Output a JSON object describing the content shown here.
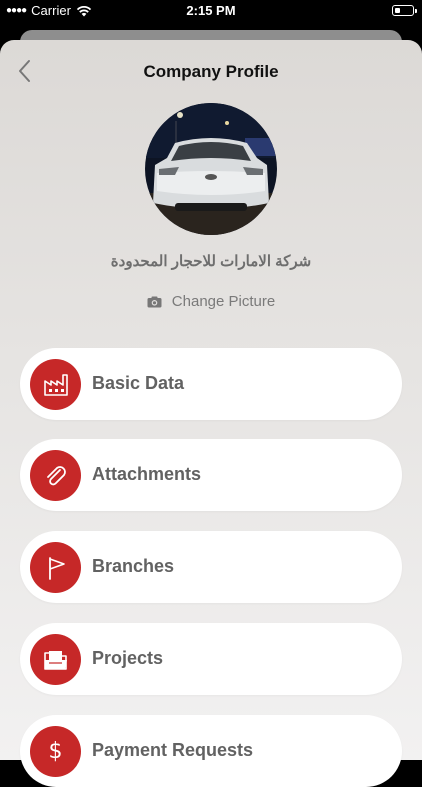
{
  "status_bar": {
    "carrier": "Carrier",
    "time": "2:15 PM"
  },
  "nav": {
    "title": "Company Profile",
    "back_icon": "chevron-left-icon"
  },
  "profile": {
    "company_name": "شركة الامارات للاحجار المحدودة",
    "change_picture_label": "Change Picture",
    "change_picture_icon": "camera-icon"
  },
  "menu": {
    "items": [
      {
        "label": "Basic Data",
        "icon": "factory-icon"
      },
      {
        "label": "Attachments",
        "icon": "paperclip-icon"
      },
      {
        "label": "Branches",
        "icon": "flag-icon"
      },
      {
        "label": "Projects",
        "icon": "folder-icon"
      },
      {
        "label": "Payment Requests",
        "icon": "dollar-icon"
      }
    ]
  },
  "colors": {
    "accent": "#c62828",
    "label_gray": "#626262"
  }
}
